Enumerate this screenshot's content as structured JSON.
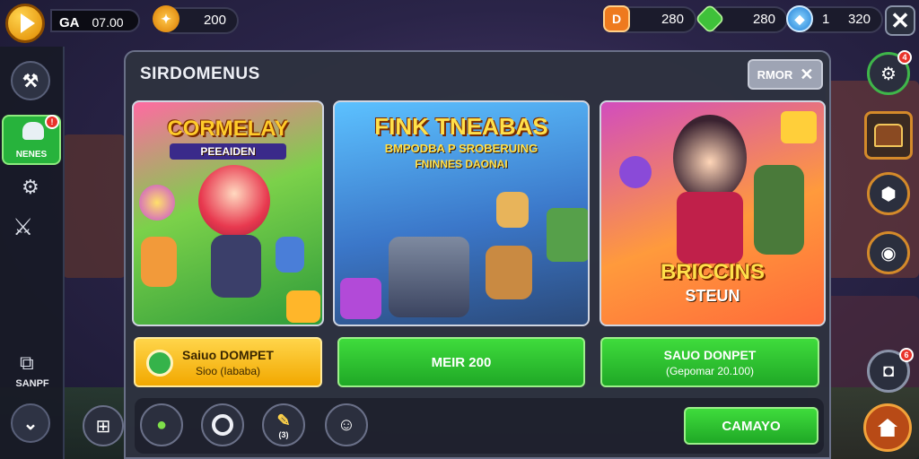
{
  "topbar": {
    "title": "GA",
    "gold_value": "07.00",
    "gem_value": "200",
    "res_orange_value": "280",
    "res_green_value": "280",
    "res_blue_count": "1",
    "res_blue_value": "320"
  },
  "sidebar": {
    "active_label": "NENES",
    "active_badge": "!",
    "bottom_label": "SANPF"
  },
  "panel": {
    "title": "SIRDOMENUS",
    "more_label": "RMOR"
  },
  "cards": [
    {
      "title": "CORMELAY",
      "subtitle": "PEEAIDEN",
      "button_title": "Saiuo DOMPET",
      "button_sub": "Sioo (Iababa)"
    },
    {
      "title": "FINK TNEABAS",
      "subtitle": "BMPODBA P SROBERUING",
      "subtitle2": "FNINNES DAONAI",
      "button_title": "MEIR 200",
      "button_sub": ""
    },
    {
      "title": "BRICCINS",
      "subtitle": "STEUN",
      "button_title": "SAUO DONPET",
      "button_sub": "(Gepomar 20.100)"
    }
  ],
  "bottom": {
    "confirm_label": "CAMAYO",
    "pen_caption": "(3)"
  },
  "right_column": {
    "badge_top": "4",
    "badge_camera": "6"
  }
}
